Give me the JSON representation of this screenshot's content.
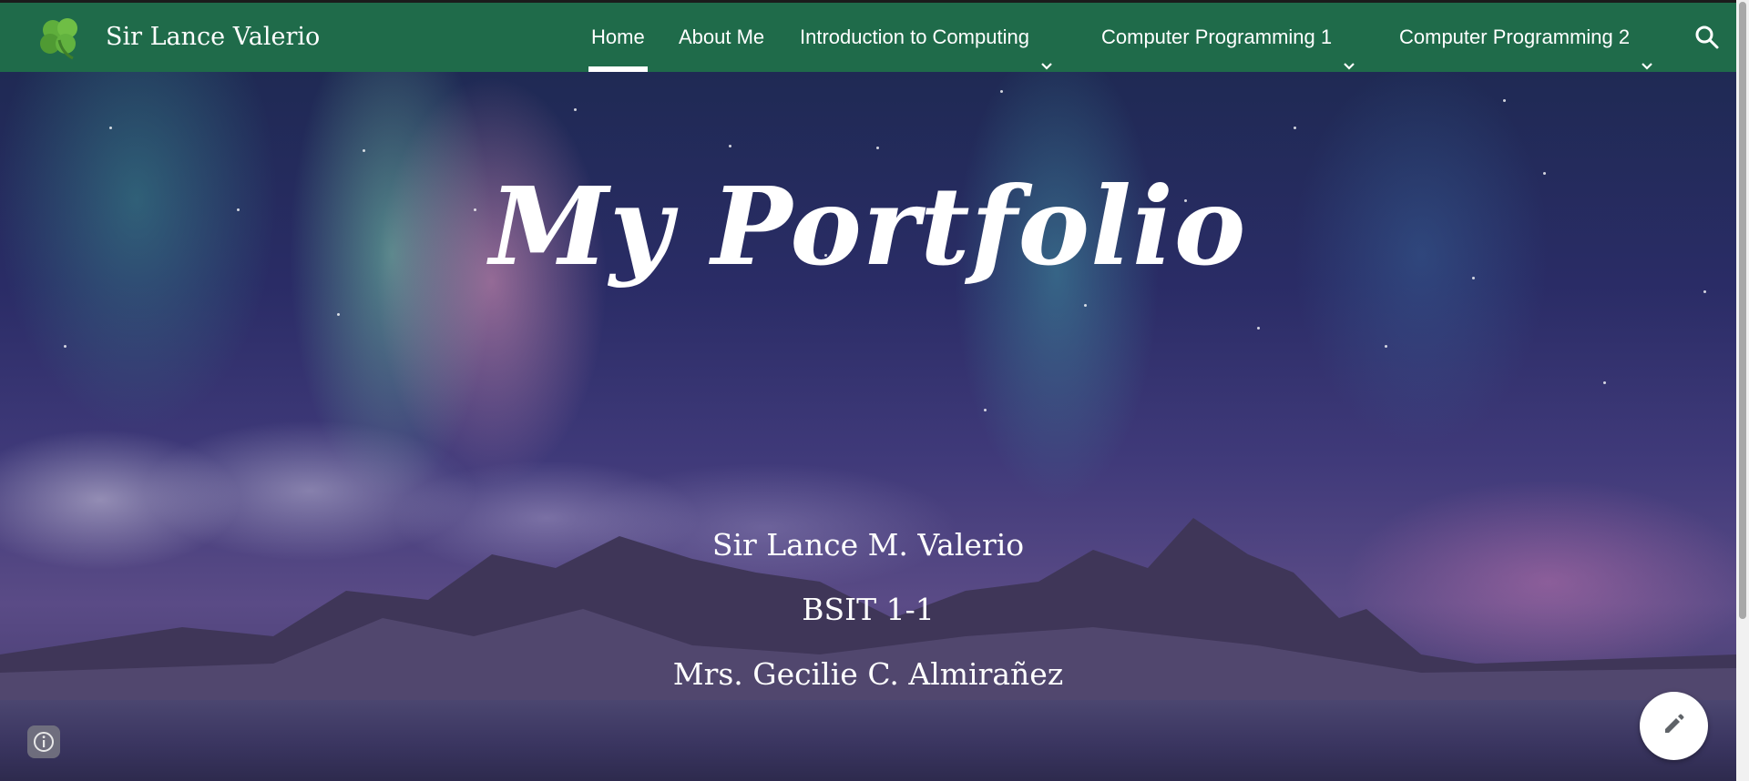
{
  "header": {
    "site_title": "Sir Lance Valerio",
    "logo_icon": "clover-icon",
    "nav": [
      {
        "label": "Home",
        "active": true,
        "has_dropdown": false
      },
      {
        "label": "About Me",
        "active": false,
        "has_dropdown": false
      },
      {
        "label": "Introduction to Computing",
        "active": false,
        "has_dropdown": true
      },
      {
        "label": "Computer Programming 1",
        "active": false,
        "has_dropdown": true
      },
      {
        "label": "Computer Programming 2",
        "active": false,
        "has_dropdown": true
      }
    ],
    "search_icon": "search-icon",
    "colors": {
      "bar": "#1f6b4a",
      "text": "#ffffff"
    }
  },
  "hero": {
    "title": "My Portfolio",
    "name": "Sir Lance M. Valerio",
    "section": "BSIT 1-1",
    "instructor": "Mrs. Gecilie C. Almirañez"
  },
  "floating": {
    "info_icon": "info-icon",
    "edit_icon": "pencil-icon"
  }
}
